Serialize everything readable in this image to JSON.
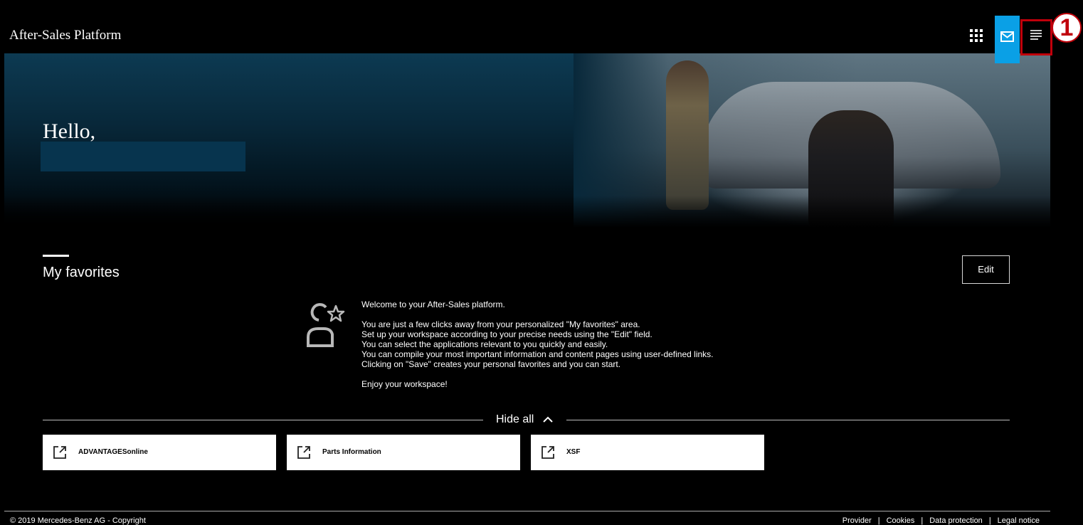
{
  "header": {
    "brand": "After-Sales Platform",
    "callout_number": "1",
    "accent_color": "#0aa0e6",
    "callout_color": "#c0000b"
  },
  "hero": {
    "greeting": "Hello,"
  },
  "favorites": {
    "title": "My favorites",
    "edit_label": "Edit",
    "welcome": {
      "title": "Welcome to your After-Sales platform.",
      "lines": [
        "You are just a few clicks away from your personalized \"My favorites\" area.",
        "Set up your workspace according to your precise needs using the \"Edit\" field.",
        "You can select the applications relevant to you quickly and easily.",
        "You can compile your most important information and content pages using user-defined links.",
        "Clicking on \"Save\" creates your personal favorites and you can start."
      ],
      "closing": "Enjoy your workspace!"
    },
    "hide_all_label": "Hide all",
    "tiles": [
      {
        "label": "ADVANTAGESonline"
      },
      {
        "label": "Parts Information"
      },
      {
        "label": "XSF"
      }
    ]
  },
  "footer": {
    "copyright": "© 2019 Mercedes-Benz AG - Copyright",
    "links": [
      "Provider",
      "Cookies",
      "Data protection",
      "Legal notice"
    ]
  }
}
